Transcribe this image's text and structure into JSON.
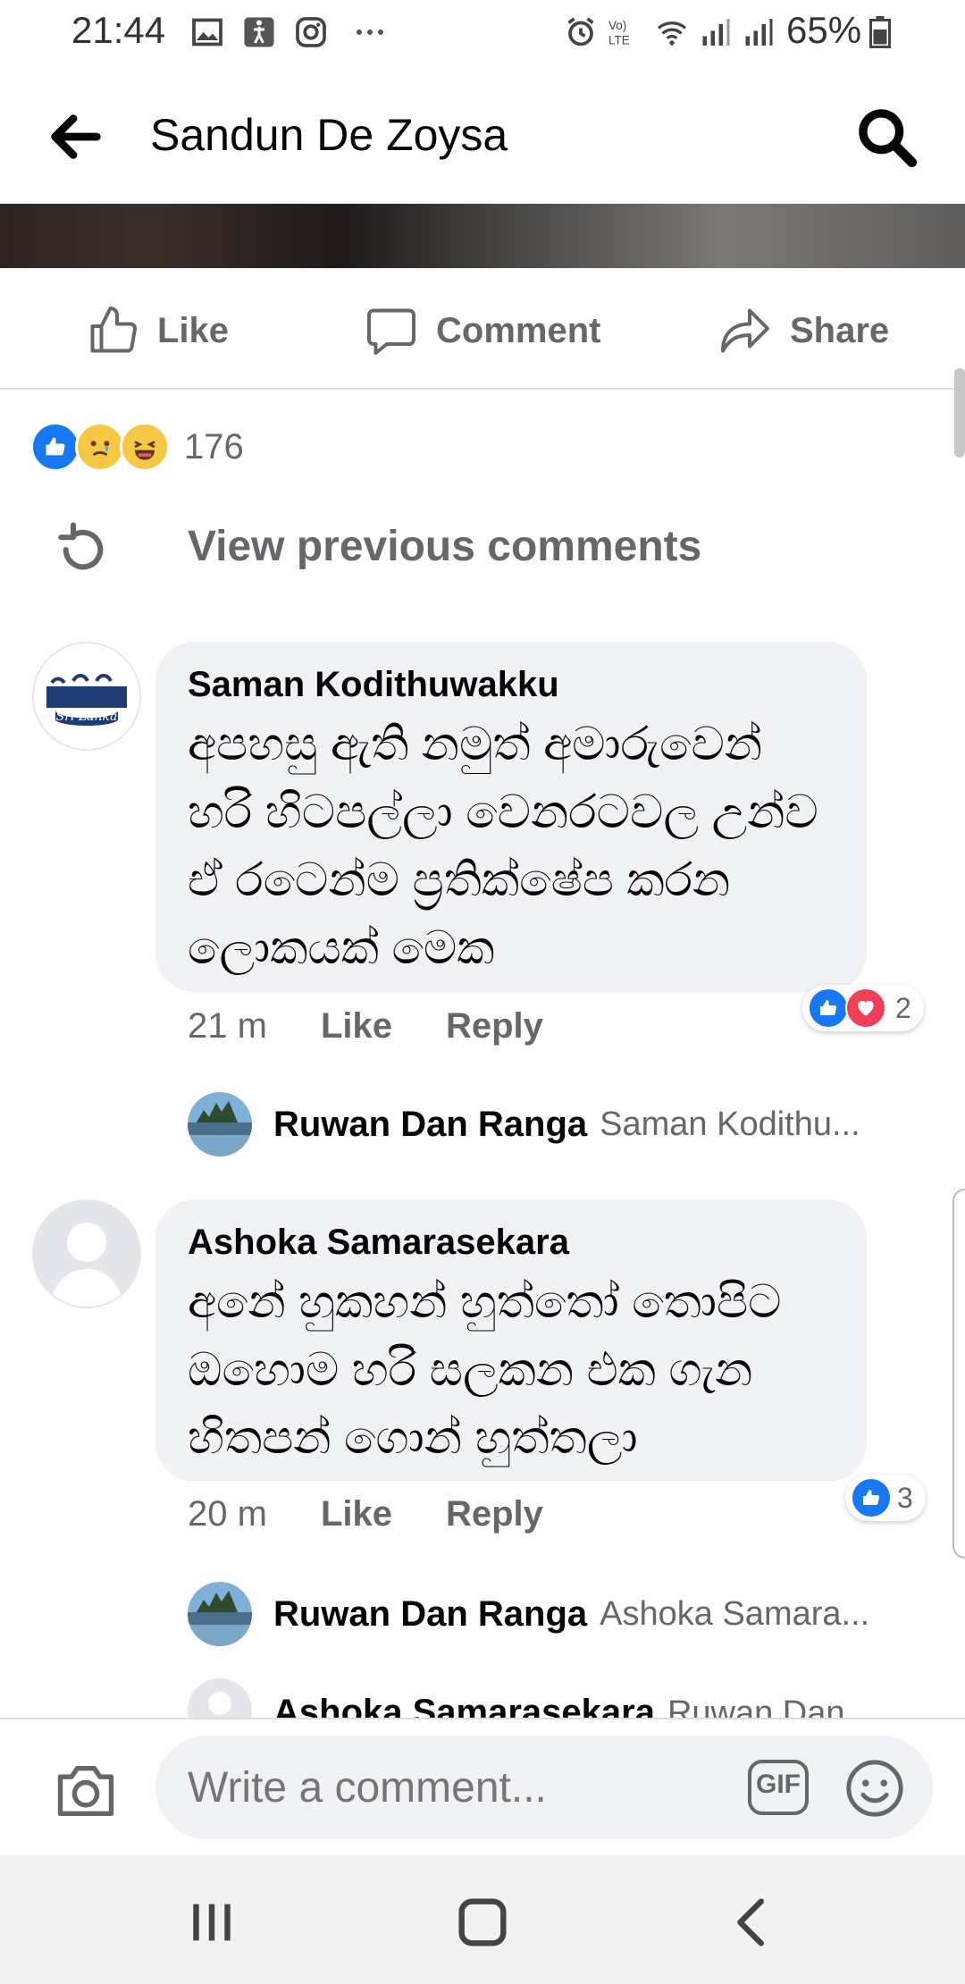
{
  "status_bar": {
    "time": "21:44",
    "battery": "65%",
    "icons": [
      "image-icon",
      "accessibility-icon",
      "instagram-icon",
      "more-dots-icon",
      "alarm-icon",
      "volte-icon",
      "wifi-icon",
      "signal-icon",
      "signal-icon",
      "battery-icon"
    ]
  },
  "header": {
    "title": "Sandun De Zoysa"
  },
  "actions": {
    "like": "Like",
    "comment": "Comment",
    "share": "Share"
  },
  "reactions": {
    "count": "176",
    "types": [
      "like",
      "sad",
      "haha"
    ]
  },
  "view_previous": "View previous comments",
  "comments": [
    {
      "author": "Saman Kodithuwakku",
      "avatar_label": "Sri Lanka",
      "lines": [
        "අපහසු ඇති නමුත් අමාරුවෙන්",
        "හරි හිටපල්ලා වෙනරටවල උන්ව",
        "ඒ  රටෙන්ම ප්‍රතික්ෂේප කරන",
        "ලොකයක් මෙක"
      ],
      "time": "21 m",
      "like": "Like",
      "reply": "Reply",
      "reaction_count": "2",
      "reply_preview": {
        "name": "Ruwan Dan Ranga",
        "text": "Saman Kodithu..."
      }
    },
    {
      "author": "Ashoka Samarasekara",
      "lines": [
        "අනේ හුකහන් හුත්තෝ තොපිට",
        "ඔහොම හරි සලකන එක ගැන",
        "හිතපන් ගොන් හුත්තලා"
      ],
      "time": "20 m",
      "like": "Like",
      "reply": "Reply",
      "reaction_count": "3",
      "reply_preview": {
        "name": "Ruwan Dan Ranga",
        "text": "Ashoka Samara..."
      },
      "reply_preview_2": {
        "name": "Ashoka Samarasekara",
        "text": "Ruwan Dan..."
      }
    }
  ],
  "composer": {
    "placeholder": "Write a comment...",
    "gif": "GIF"
  },
  "colors": {
    "fb_blue": "#1877f2",
    "love_red": "#f33e58",
    "bubble_bg": "#f0f2f5",
    "secondary_text": "#65676b"
  }
}
